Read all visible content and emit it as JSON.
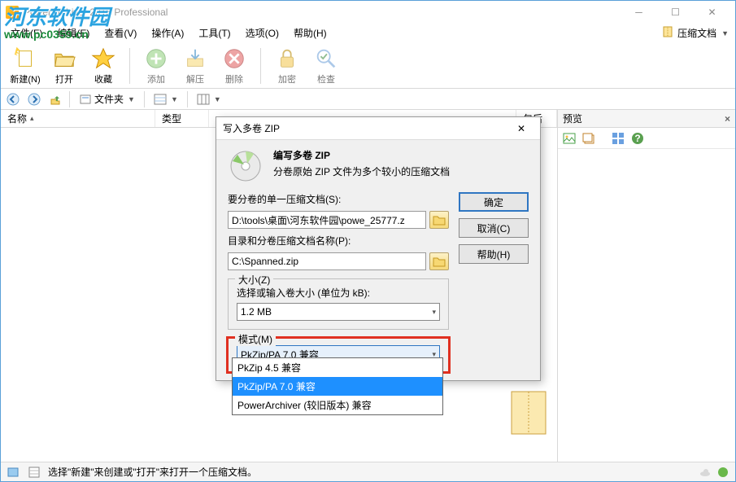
{
  "window": {
    "title": "PowerArchiver 2015 Professional"
  },
  "menubar": {
    "items": [
      "文件(F)",
      "编辑(E)",
      "查看(V)",
      "操作(A)",
      "工具(T)",
      "选项(O)",
      "帮助(H)"
    ],
    "right": {
      "archive_label": "压缩文档"
    }
  },
  "toolbar": {
    "groups": [
      [
        {
          "name": "new-button",
          "label": "新建(N)",
          "icon": "new",
          "enabled": true
        },
        {
          "name": "open-button",
          "label": "打开",
          "icon": "open",
          "enabled": true
        },
        {
          "name": "fav-button",
          "label": "收藏",
          "icon": "fav",
          "enabled": true
        }
      ],
      [
        {
          "name": "add-button",
          "label": "添加",
          "icon": "add",
          "enabled": false
        },
        {
          "name": "extract-button",
          "label": "解压",
          "icon": "extract",
          "enabled": false
        },
        {
          "name": "delete-button",
          "label": "删除",
          "icon": "delete",
          "enabled": false
        }
      ],
      [
        {
          "name": "encrypt-button",
          "label": "加密",
          "icon": "encrypt",
          "enabled": false
        },
        {
          "name": "check-button",
          "label": "检查",
          "icon": "check",
          "enabled": false
        }
      ]
    ]
  },
  "navbar": {
    "folder_label": "文件夹"
  },
  "columns": [
    "名称",
    "类型",
    "",
    "包后"
  ],
  "preview": {
    "title": "预览"
  },
  "statusbar": {
    "text": "选择\"新建\"来创建或\"打开\"来打开一个压缩文档。"
  },
  "watermark": {
    "text": "河东软件园",
    "url": "www.pc0359.cn"
  },
  "dialog": {
    "title": "写入多卷 ZIP",
    "hero_title": "编写多卷 ZIP",
    "hero_desc": "分卷原始 ZIP 文件为多个较小的压缩文档",
    "label_source": "要分卷的单一压缩文档(S):",
    "value_source": "D:\\tools\\桌面\\河东软件园\\powe_25777.z",
    "label_dest": "目录和分卷压缩文档名称(P):",
    "value_dest": "C:\\Spanned.zip",
    "legend_size": "大小(Z)",
    "label_size": "选择或输入卷大小 (单位为 kB):",
    "value_size": "1.2 MB",
    "legend_mode": "模式(M)",
    "value_mode": "PkZip/PA 7.0 兼容",
    "btn_ok": "确定",
    "btn_cancel": "取消(C)",
    "btn_help": "帮助(H)",
    "dropdown_options": [
      "PkZip 4.5 兼容",
      "PkZip/PA 7.0 兼容",
      "PowerArchiver (较旧版本) 兼容"
    ],
    "dropdown_selected_index": 1
  }
}
